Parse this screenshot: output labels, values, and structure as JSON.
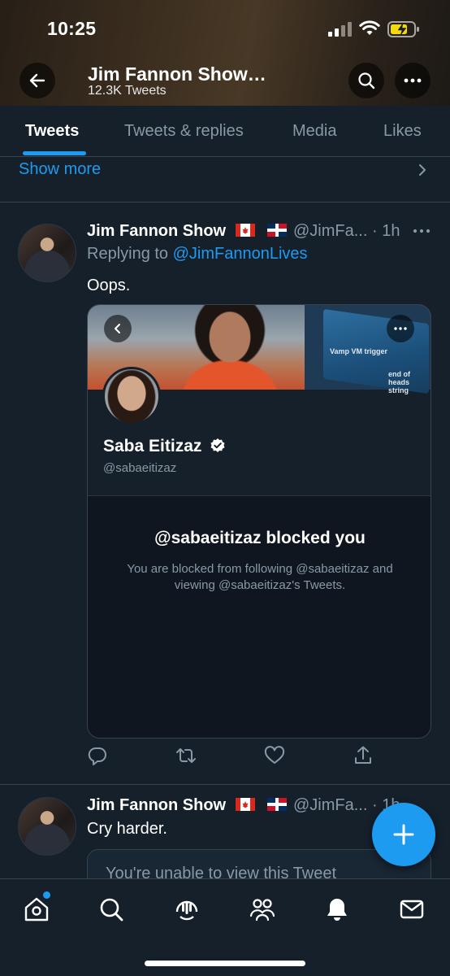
{
  "status_bar": {
    "time": "10:25"
  },
  "header": {
    "title": "Jim Fannon Show…",
    "subtitle": "12.3K Tweets"
  },
  "tabs": [
    {
      "label": "Tweets",
      "active": true
    },
    {
      "label": "Tweets & replies",
      "active": false
    },
    {
      "label": "Media",
      "active": false
    },
    {
      "label": "Likes",
      "active": false
    }
  ],
  "show_more": "Show more",
  "tweets": [
    {
      "name": "Jim Fannon Show",
      "flags": [
        "canada-flag",
        "dominican-republic-flag"
      ],
      "handle": "@JimFa...",
      "time": "· 1h",
      "replying_prefix": "Replying to",
      "replying_to": "@JimFannonLives",
      "text": "Oops.",
      "profile_card": {
        "name": "Saba Eitizaz",
        "handle": "@sabaeitizaz",
        "verified": true,
        "blocked_title": "@sabaeitizaz blocked you",
        "blocked_desc": "You are blocked from following @sabaeitizaz and viewing @sabaeitizaz's Tweets.",
        "banner_tags": [
          "Vamp VM trigger",
          "end of heads string"
        ]
      }
    },
    {
      "name": "Jim Fannon Show",
      "flags": [
        "canada-flag",
        "dominican-republic-flag"
      ],
      "handle": "@JimFa...",
      "time": "· 1h",
      "text": "Cry harder.",
      "unavailable_text": "You're unable to view this Tweet"
    }
  ],
  "bottom_nav": [
    "home-icon",
    "search-icon",
    "spaces-icon",
    "communities-icon",
    "notifications-icon",
    "messages-icon"
  ],
  "colors": {
    "accent": "#1d9bf0",
    "background": "#15202b",
    "muted": "#8899a6",
    "border": "#38444d"
  }
}
